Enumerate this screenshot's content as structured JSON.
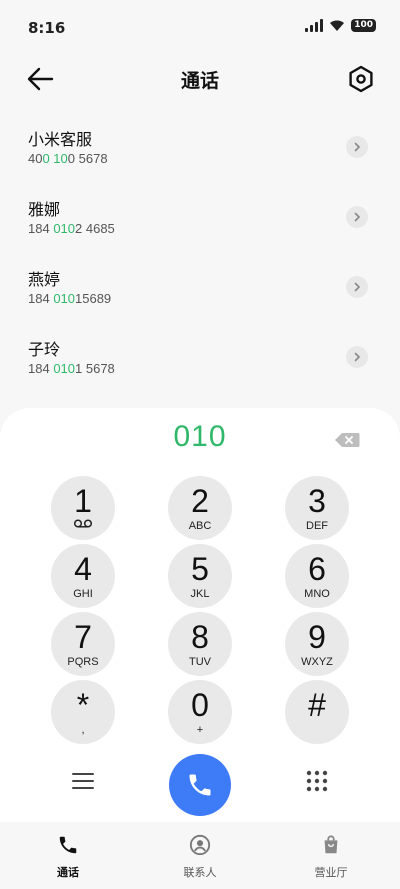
{
  "status_bar": {
    "time": "8:16",
    "battery": "100",
    "icons": [
      "signal-icon",
      "wifi-icon",
      "battery-icon"
    ]
  },
  "header": {
    "title": "通话",
    "back_icon": "back-arrow-icon",
    "settings_icon": "settings-hexagon-icon"
  },
  "contacts": [
    {
      "name": "小米客服",
      "number_parts": [
        "40",
        "0 10",
        "0 5678"
      ]
    },
    {
      "name": "雅娜",
      "number_parts": [
        "184 ",
        "010",
        "2 4685"
      ]
    },
    {
      "name": "燕婷",
      "number_parts": [
        "184 ",
        "010",
        "15689"
      ]
    },
    {
      "name": "子玲",
      "number_parts": [
        "184 ",
        "010",
        "1 5678"
      ]
    }
  ],
  "dialpad": {
    "input_value": "010",
    "keys": [
      {
        "digit": "1",
        "letters": ""
      },
      {
        "digit": "2",
        "letters": "ABC"
      },
      {
        "digit": "3",
        "letters": "DEF"
      },
      {
        "digit": "4",
        "letters": "GHI"
      },
      {
        "digit": "5",
        "letters": "JKL"
      },
      {
        "digit": "6",
        "letters": "MNO"
      },
      {
        "digit": "7",
        "letters": "PQRS"
      },
      {
        "digit": "8",
        "letters": "TUV"
      },
      {
        "digit": "9",
        "letters": "WXYZ"
      },
      {
        "digit": "*",
        "letters": ","
      },
      {
        "digit": "0",
        "letters": "+"
      },
      {
        "digit": "#",
        "letters": ""
      }
    ]
  },
  "bottom_nav": {
    "calls": "通话",
    "contacts": "联系人",
    "business": "营业厅"
  },
  "colors": {
    "highlight_green": "#2fb86a",
    "call_blue": "#3d7bf7",
    "key_gray": "#e9e9e9"
  }
}
